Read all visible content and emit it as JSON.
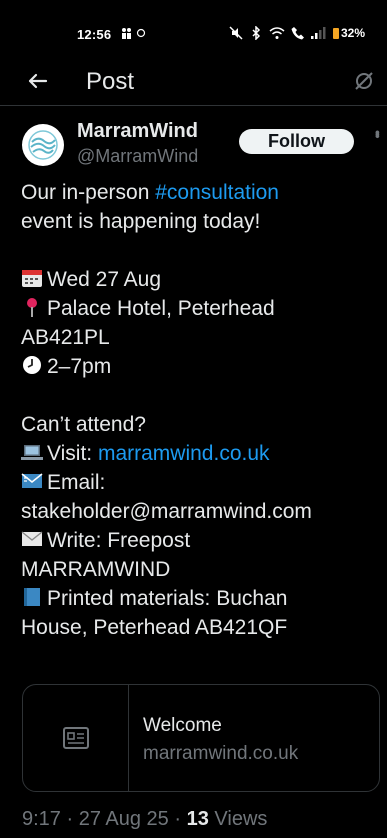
{
  "status_bar": {
    "time": "12:56",
    "left_icons": "⓪",
    "battery": "32%",
    "colors": {
      "battery": "#f5a623"
    }
  },
  "header": {
    "title": "Post"
  },
  "author": {
    "name": "MarramWind",
    "handle": "@MarramWind",
    "follow_label": "Follow"
  },
  "tweet": {
    "l1_pre": "Our in-person ",
    "l1_link": "#consultation",
    "l2": "event is happening today!",
    "date": "Wed 27 Aug",
    "location_1": "Palace Hotel, Peterhead",
    "location_2": "AB421PL",
    "time": "2–7pm",
    "cant_attend": "Can’t attend?",
    "visit_label": "Visit: ",
    "visit_link": "marramwind.co.uk",
    "email_label": "Email:",
    "email_value": "stakeholder@marramwind.com",
    "write_label": "Write: Freepost",
    "write_value": "MARRAMWIND",
    "printed_1": "Printed materials: Buchan",
    "printed_2": "House, Peterhead AB421QF"
  },
  "card": {
    "title": "Welcome",
    "domain": "marramwind.co.uk"
  },
  "meta": {
    "time": "9:17",
    "sep1": " · ",
    "date": "27 Aug 25",
    "sep2": " · ",
    "views_count": "13",
    "views_label": " Views"
  },
  "colors": {
    "background": "#000000",
    "text": "#e7e9ea",
    "muted": "#71767b",
    "link": "#1d9bf0",
    "border": "#2f3336"
  }
}
